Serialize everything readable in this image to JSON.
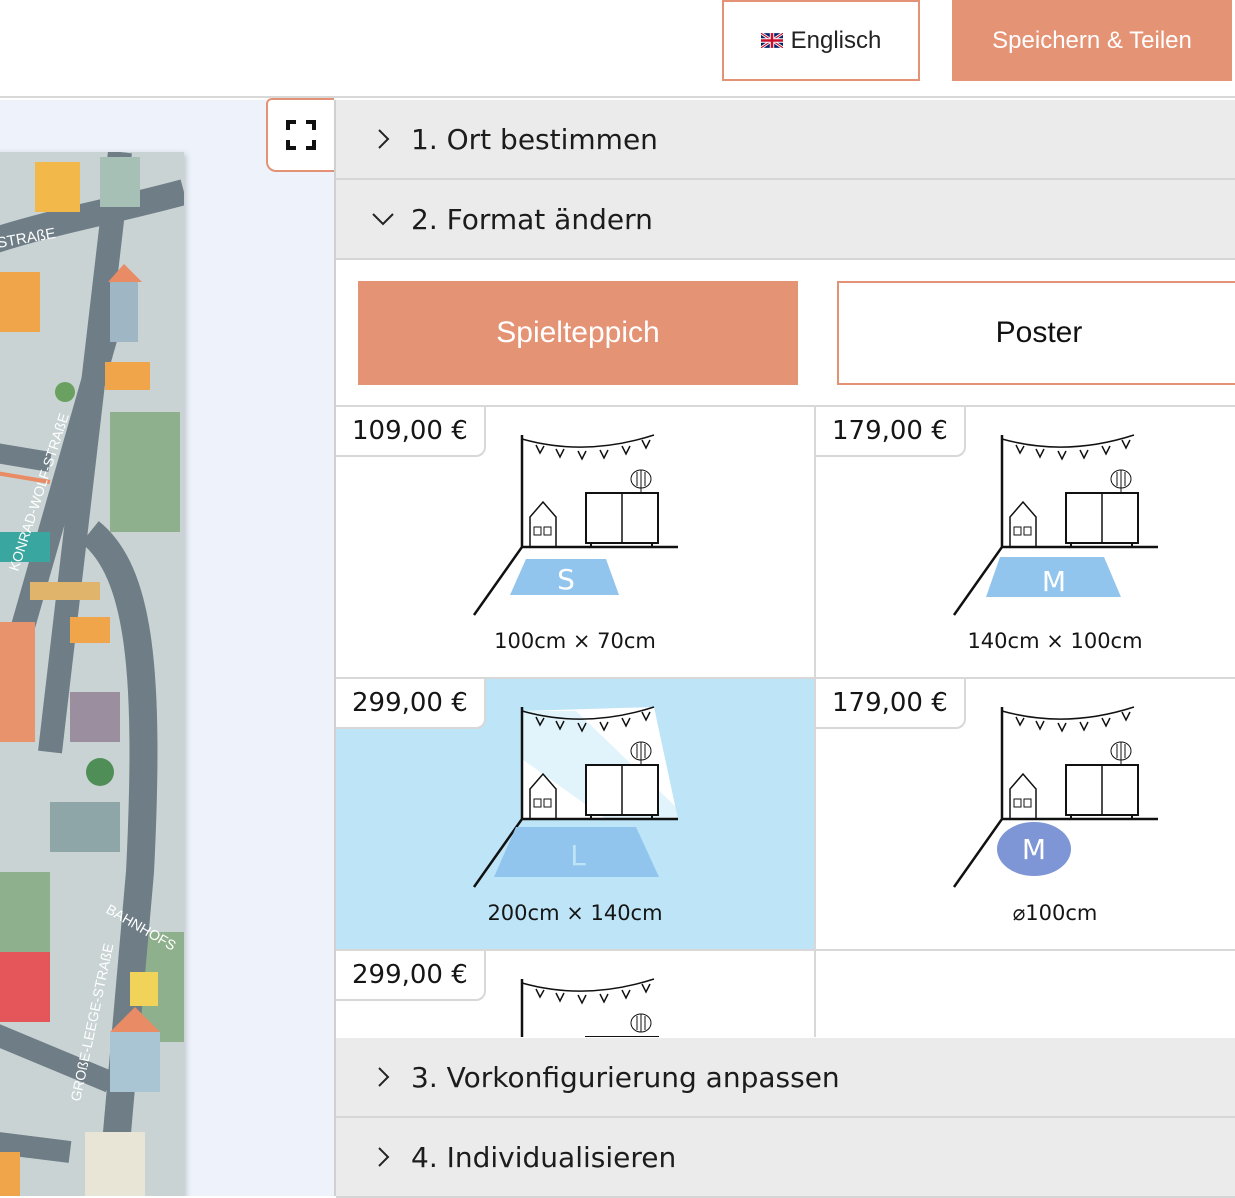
{
  "header": {
    "language_label": "Englisch",
    "save_share_label": "Speichern & Teilen"
  },
  "accordion": {
    "step1": "1. Ort bestimmen",
    "step2": "2. Format ändern",
    "step3": "3. Vorkonfigurierung anpassen",
    "step4": "4. Individualisieren"
  },
  "format": {
    "options": [
      "Spielteppich",
      "Poster"
    ],
    "selected": "Spielteppich"
  },
  "products": [
    {
      "price": "109,00 €",
      "size_letter": "S",
      "dimensions": "100cm × 70cm",
      "shape": "rect",
      "selected": false
    },
    {
      "price": "179,00 €",
      "size_letter": "M",
      "dimensions": "140cm × 100cm",
      "shape": "rect",
      "selected": false
    },
    {
      "price": "299,00 €",
      "size_letter": "L",
      "dimensions": "200cm × 140cm",
      "shape": "rect",
      "selected": true
    },
    {
      "price": "179,00 €",
      "size_letter": "M",
      "dimensions": "⌀100cm",
      "shape": "round",
      "selected": false
    },
    {
      "price": "299,00 €",
      "size_letter": "",
      "dimensions": "",
      "shape": "rect",
      "selected": false
    }
  ],
  "map_labels": [
    "STRAßE",
    "KONRAD-WOLF-STRAßE",
    "BAHNHOFS",
    "GROßE-LEEGE-STRAßE"
  ],
  "colors": {
    "accent": "#e59375",
    "selected_bg": "#bde4f7",
    "rug_blue": "#92c5ee",
    "round_rug": "#7e95d6"
  },
  "icons": [
    "uk-flag-icon",
    "fullscreen-icon",
    "chevron-right-icon",
    "chevron-down-icon"
  ]
}
